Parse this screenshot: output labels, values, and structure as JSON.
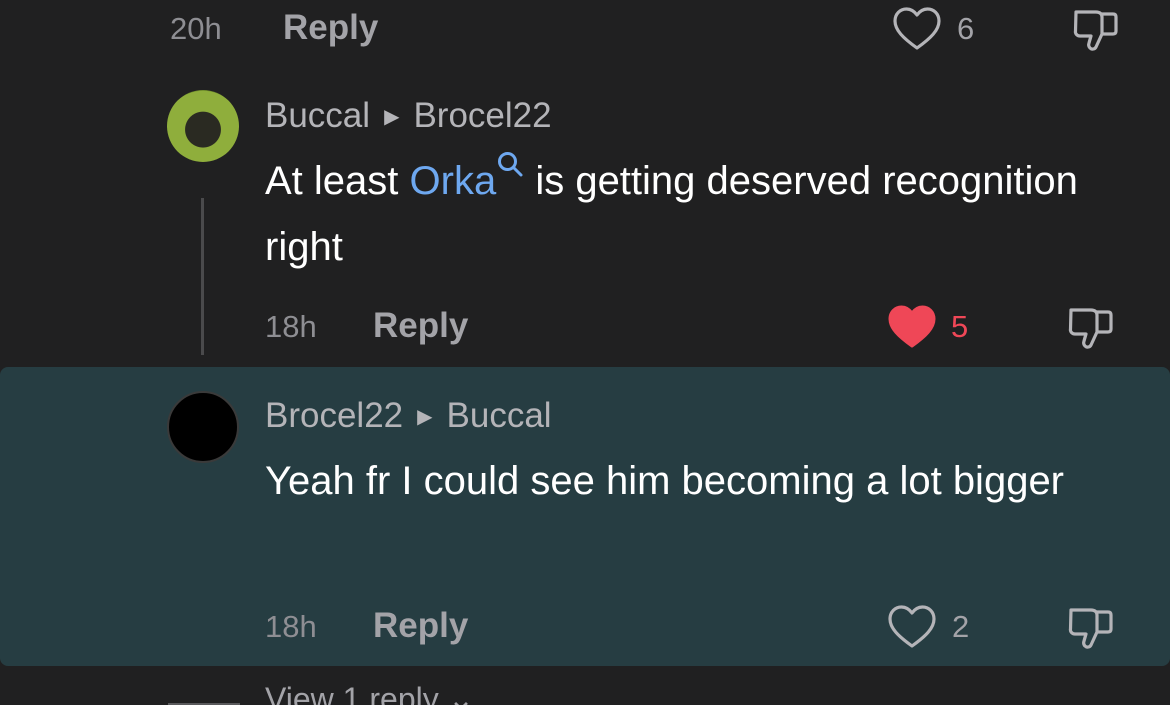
{
  "top_comment": {
    "time": "20h",
    "reply_label": "Reply",
    "like_count": "6",
    "liked": false
  },
  "reply_1": {
    "author": "Buccal",
    "reply_to": "Brocel22",
    "text_before": "At least ",
    "mention": "Orka",
    "text_after": " is getting deserved recognition right",
    "time": "18h",
    "reply_label": "Reply",
    "like_count": "5",
    "liked": true
  },
  "reply_2": {
    "author": "Brocel22",
    "reply_to": "Buccal",
    "text": "Yeah fr I could see him becoming a lot bigger",
    "time": "18h",
    "reply_label": "Reply",
    "like_count": "2",
    "liked": false
  },
  "view_replies_label": "View 1 reply",
  "icons": {
    "like": "heart-icon",
    "dislike": "thumbs-down-icon",
    "search": "search-icon",
    "arrow": "caret-right-icon",
    "expand": "chevron-down-icon"
  },
  "colors": {
    "background": "#202021",
    "highlight": "#263d42",
    "liked_red": "#ef4757",
    "mention_blue": "#6ea8f0"
  }
}
